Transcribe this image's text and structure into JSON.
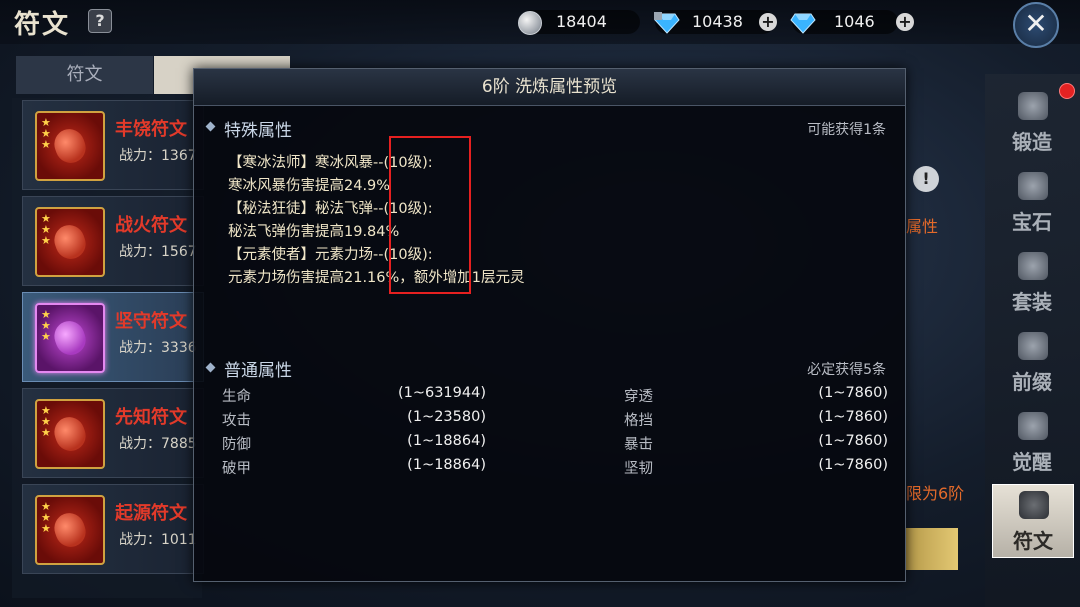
{
  "header": {
    "title": "符文",
    "help": "?",
    "currency_silver": "18404",
    "currency_bound_diamond": "10438",
    "currency_diamond": "1046",
    "plus": "+",
    "close": "✕"
  },
  "left_tabs": [
    "符文"
  ],
  "runes": [
    {
      "name": "丰饶符文",
      "power": "战力：1367",
      "selected": false,
      "color": "red"
    },
    {
      "name": "战火符文",
      "power": "战力：1567",
      "selected": false,
      "color": "red"
    },
    {
      "name": "坚守符文",
      "power": "战力：3336",
      "selected": true,
      "color": "purple"
    },
    {
      "name": "先知符文",
      "power": "战力：7885",
      "selected": false,
      "color": "red"
    },
    {
      "name": "起源符文",
      "power": "战力：1011",
      "selected": false,
      "color": "red"
    }
  ],
  "sidebar": [
    {
      "label": "锻造",
      "active": false
    },
    {
      "label": "宝石",
      "active": false
    },
    {
      "label": "套装",
      "active": false
    },
    {
      "label": "前缀",
      "active": false
    },
    {
      "label": "觉醒",
      "active": false
    },
    {
      "label": "符文",
      "active": true
    }
  ],
  "background": {
    "attr_text": "属性",
    "limit_text": "限为6阶"
  },
  "modal": {
    "title": "6阶 洗炼属性预览",
    "special": {
      "heading": "特殊属性",
      "note": "可能获得1条",
      "lines": [
        "【寒冰法师】寒冰风暴--(10级):",
        "寒冰风暴伤害提高24.9%",
        "【秘法狂徒】秘法飞弹--(10级):",
        "秘法飞弹伤害提高19.84%",
        "【元素使者】元素力场--(10级):",
        "元素力场伤害提高21.16%，额外增加1层元灵"
      ]
    },
    "normal": {
      "heading": "普通属性",
      "note": "必定获得5条",
      "left": [
        {
          "name": "生命",
          "range": "(1~631944)"
        },
        {
          "name": "攻击",
          "range": "(1~23580)"
        },
        {
          "name": "防御",
          "range": "(1~18864)"
        },
        {
          "name": "破甲",
          "range": "(1~18864)"
        }
      ],
      "right": [
        {
          "name": "穿透",
          "range": "(1~7860)"
        },
        {
          "name": "格挡",
          "range": "(1~7860)"
        },
        {
          "name": "暴击",
          "range": "(1~7860)"
        },
        {
          "name": "坚韧",
          "range": "(1~7860)"
        }
      ]
    }
  },
  "colors": {
    "rune_name": "#e33a2a",
    "highlight_box": "#e62020",
    "gem_blue": "#3ab4ff"
  }
}
